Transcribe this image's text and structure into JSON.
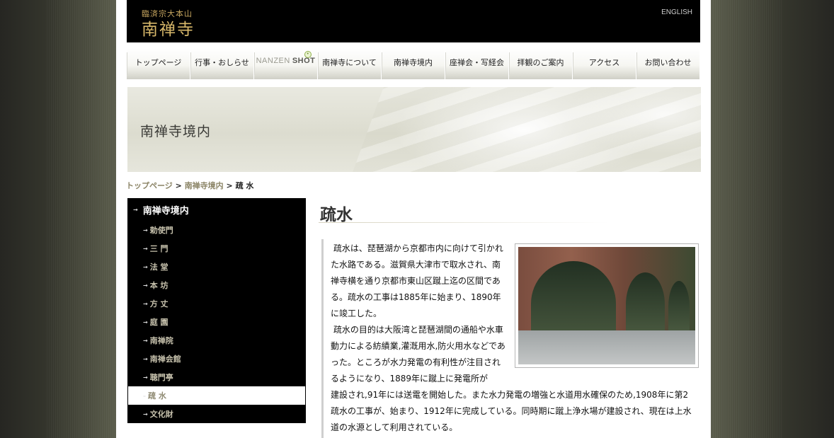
{
  "header": {
    "logo_small": "臨済宗大本山",
    "logo_big": "南禅寺",
    "english_link": "ENGLISH"
  },
  "nav": {
    "items": [
      {
        "label": "トップページ"
      },
      {
        "label": "行事・おしらせ"
      },
      {
        "label_light": "NANZEN",
        "label_bold": "SHOT"
      },
      {
        "label": "南禅寺について"
      },
      {
        "label": "南禅寺境内"
      },
      {
        "label": "座禅会・写経会"
      },
      {
        "label": "拝観のご案内"
      },
      {
        "label": "アクセス"
      },
      {
        "label": "お問い合わせ"
      }
    ]
  },
  "banner": {
    "title": "南禅寺境内"
  },
  "breadcrumb": {
    "home": "トップページ",
    "sep": ">",
    "section": "南禅寺境内",
    "current": "疏 水"
  },
  "sidebar": {
    "heading": "南禅寺境内",
    "items": [
      {
        "label": "勅使門"
      },
      {
        "label": "三 門"
      },
      {
        "label": "法 堂"
      },
      {
        "label": "本 坊"
      },
      {
        "label": "方 丈"
      },
      {
        "label": "庭 園"
      },
      {
        "label": "南禅院"
      },
      {
        "label": "南禅会館"
      },
      {
        "label": "聴門亭"
      },
      {
        "label": "疏 水",
        "active": true
      },
      {
        "label": "文化財"
      }
    ]
  },
  "content": {
    "title": "疏水",
    "para1": "疏水は、琵琶湖から京都市内に向けて引かれた水路である。滋賀県大津市で取水され、南禅寺横を通り京都市東山区蹴上迄の区間である。疏水の工事は1885年に始まり、1890年に竣工した。",
    "para2a": "疏水の目的は大阪湾と琵琶湖間の通船や水車動力による紡績業,灌漑用水,防火用水などであった。ところが水力発電の有利性が注目されるようになり、1889年に蹴上に発電所が",
    "para2b": "建設され,91年には送電を開始した。また水力発電の増強と水道用水確保のため,1908年に第2疏水の工事が、始まり、1912年に完成している。同時期に蹴上浄水場が建設され、現在は上水道の水源として利用されている。"
  },
  "icons": {
    "nav_badge": "new-badge-icon",
    "list_arrow": "arrow-icon"
  }
}
